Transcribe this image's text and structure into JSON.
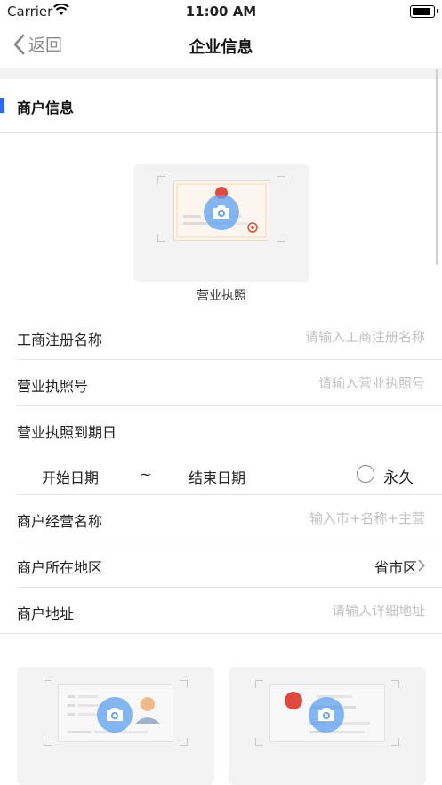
{
  "status_bar": {
    "carrier": "Carrier",
    "time": "11:00 AM"
  },
  "nav": {
    "back_label": "返回",
    "title": "企业信息"
  },
  "section": {
    "title": "商户信息"
  },
  "license_upload": {
    "caption": "营业执照"
  },
  "fields": {
    "business_reg_name": {
      "label": "工商注册名称",
      "placeholder": "请输入工商注册名称",
      "value": ""
    },
    "license_number": {
      "label": "营业执照号",
      "placeholder": "请输入营业执照号",
      "value": ""
    },
    "license_expiry": {
      "label": "营业执照到期日"
    },
    "merchant_name": {
      "label": "商户经营名称",
      "placeholder": "输入市+名称+主营",
      "value": ""
    },
    "merchant_region": {
      "label": "商户所在地区",
      "value": "省市区"
    },
    "merchant_address": {
      "label": "商户地址",
      "placeholder": "请输入详细地址",
      "value": ""
    }
  },
  "date_range": {
    "start": "开始日期",
    "separator": "~",
    "end": "结束日期",
    "forever": "永久",
    "forever_checked": false
  },
  "colors": {
    "accent": "#2c68f5",
    "camera_badge": "#5aa0f0"
  }
}
